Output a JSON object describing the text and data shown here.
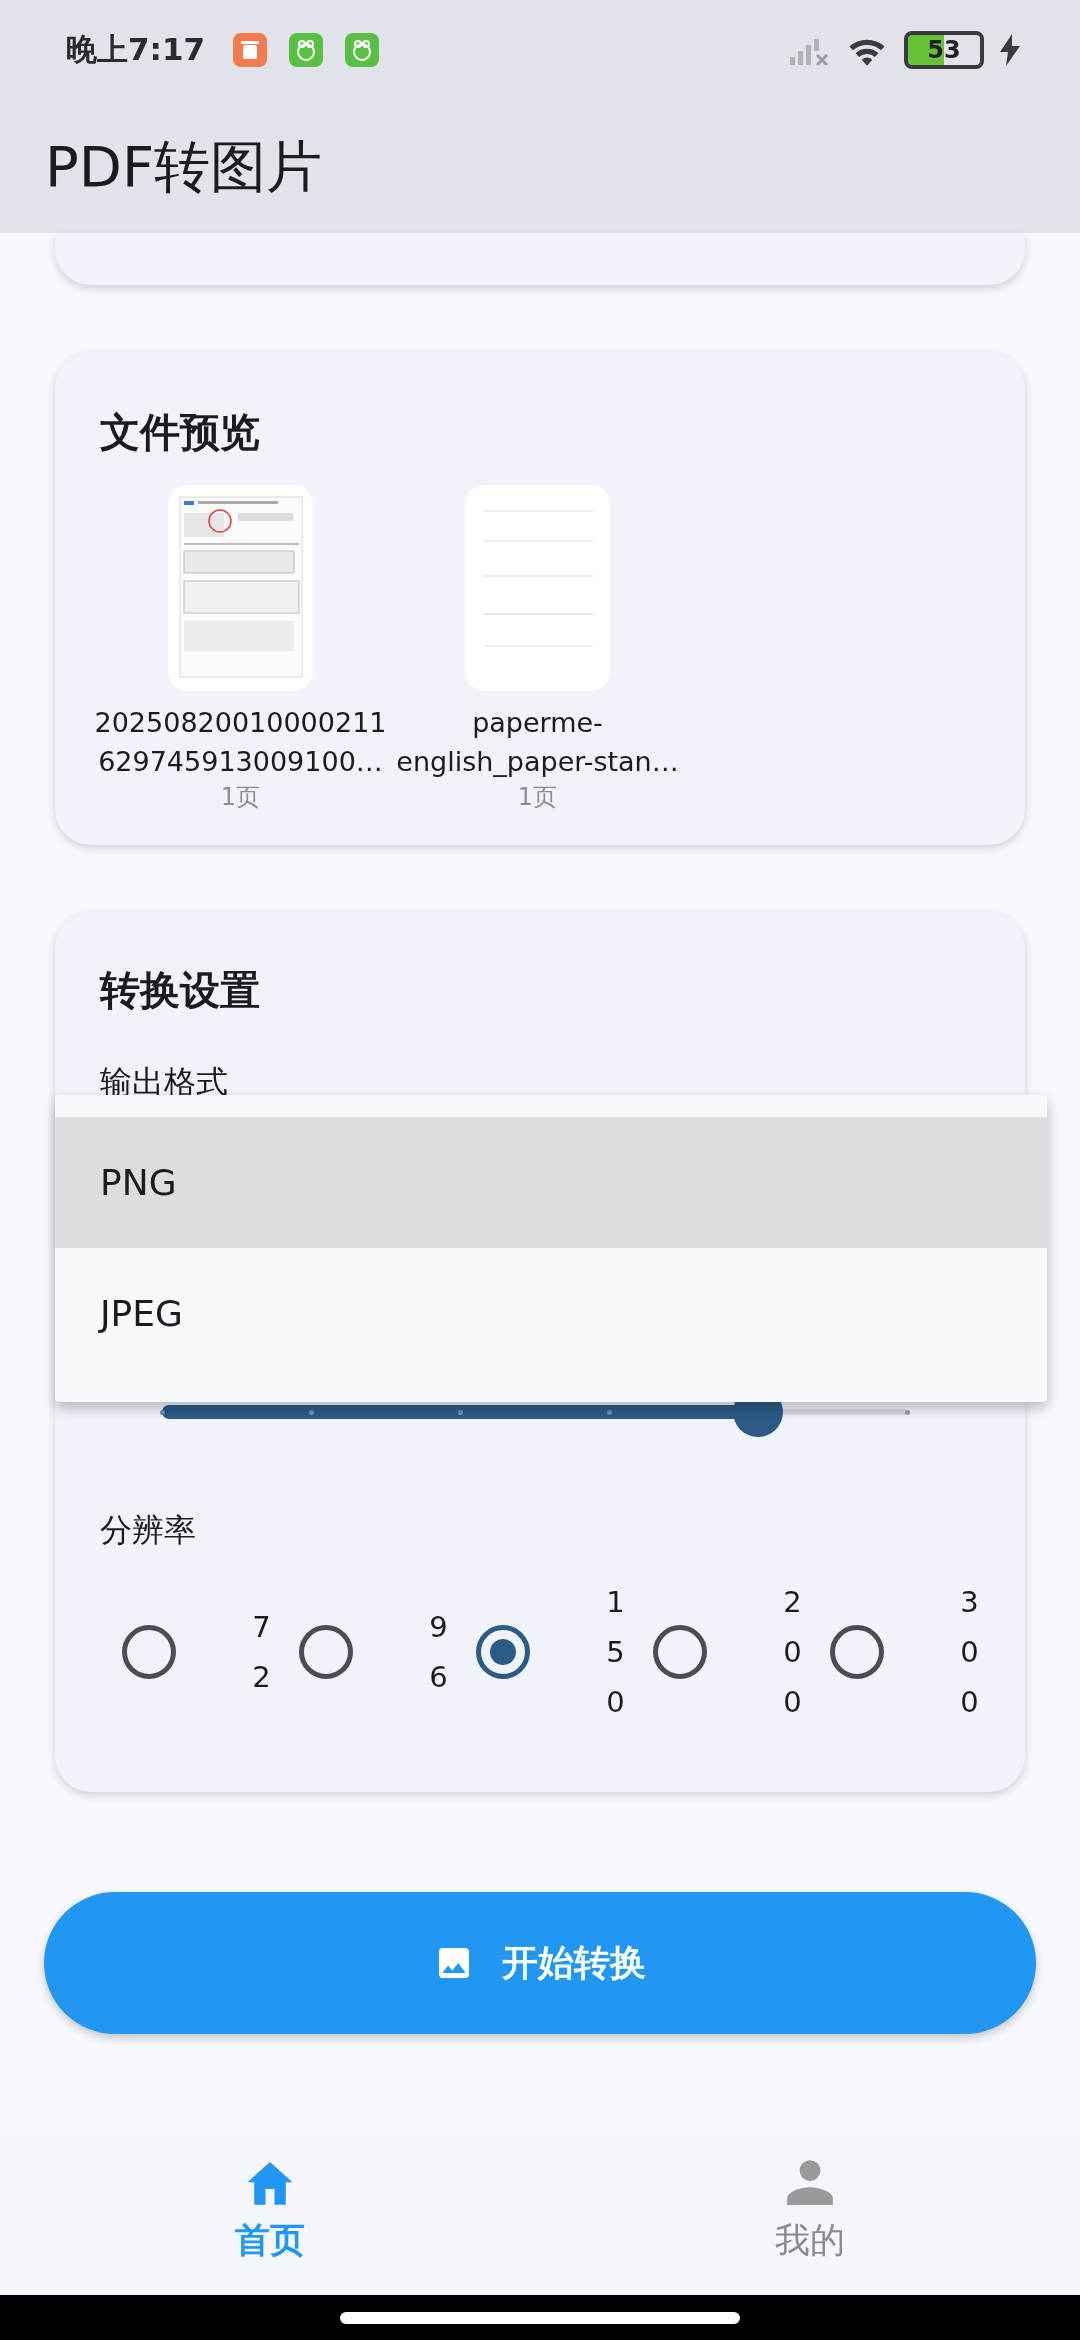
{
  "status_bar": {
    "time": "晚上7:17",
    "battery": "53"
  },
  "app_bar": {
    "title": "PDF转图片"
  },
  "file_preview": {
    "title": "文件预览",
    "files": [
      {
        "name_lines": [
          "20250820010000211",
          "629745913009100…"
        ],
        "pages": "1页",
        "kind": "picture"
      },
      {
        "name_lines": [
          "paperme-",
          "english_paper-stan…"
        ],
        "pages": "1页",
        "kind": "picture"
      }
    ]
  },
  "settings": {
    "title": "转换设置",
    "format_label": "输出格式",
    "format_menu": [
      {
        "label": "PNG",
        "selected": true
      },
      {
        "label": "JPEG",
        "selected": false
      }
    ],
    "slider": {
      "level": 0.8
    },
    "resolution_label": "分辨率",
    "resolutions": [
      {
        "label": "72",
        "selected": false
      },
      {
        "label": "96",
        "selected": false
      },
      {
        "label": "150",
        "selected": true
      },
      {
        "label": "200",
        "selected": false
      },
      {
        "label": "300",
        "selected": false
      }
    ]
  },
  "start_button": {
    "label": "开始转换"
  },
  "bottom_nav": [
    {
      "label": "首页",
      "kind": "home",
      "selected": true
    },
    {
      "label": "我的",
      "kind": "profile",
      "selected": false
    }
  ]
}
